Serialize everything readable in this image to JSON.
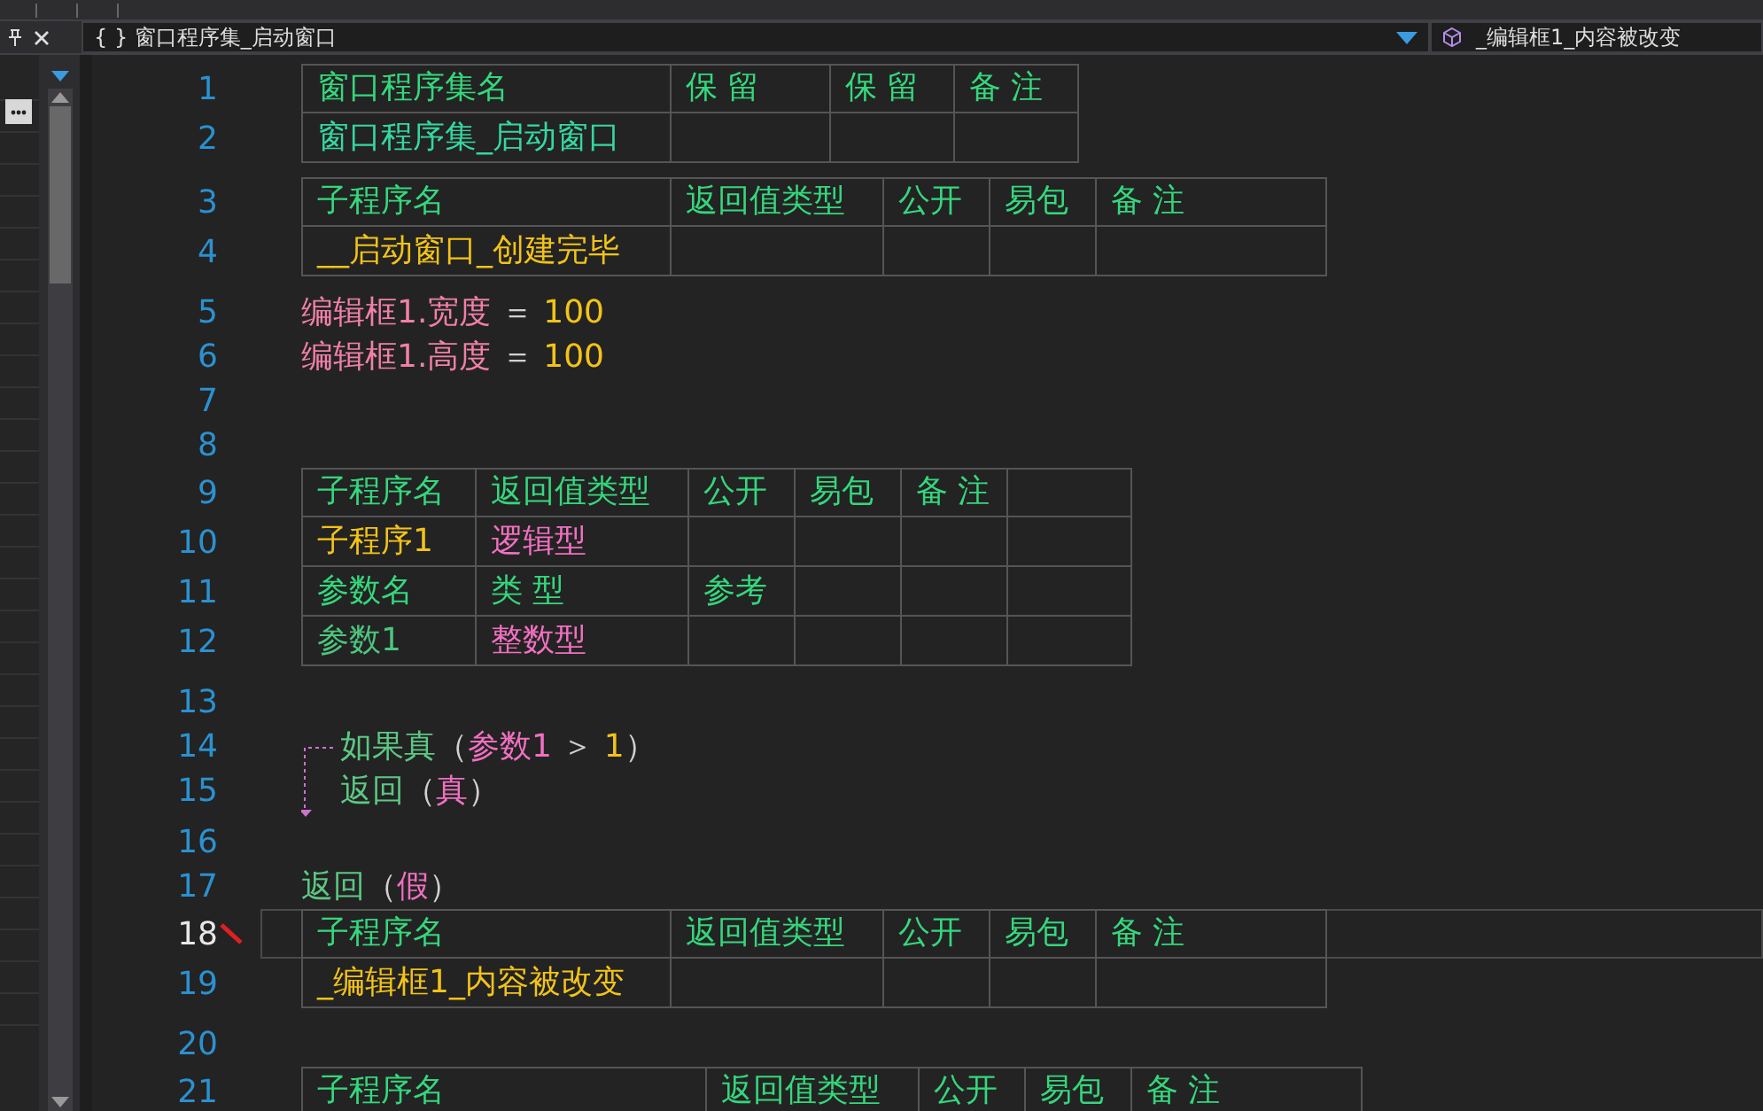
{
  "tab_bar": {
    "class_selector": "{ } 窗口程序集_启动窗口",
    "method_selector": "_编辑框1_内容被改变"
  },
  "lines": [
    {
      "kind": "table",
      "rows": [
        {
          "number": "1",
          "current": false,
          "cells": [
            {
              "text": "窗口程序集名",
              "color": "#35d77c"
            },
            {
              "text": "保 留",
              "color": "#35d77c"
            },
            {
              "text": "保 留",
              "color": "#35d77c"
            },
            {
              "text": "备 注",
              "color": "#35d77c"
            }
          ]
        },
        {
          "number": "2",
          "current": false,
          "cells": [
            {
              "text": "窗口程序集_启动窗口",
              "color": "#35d7a0"
            }
          ]
        }
      ]
    },
    {
      "kind": "table",
      "rows": [
        {
          "number": "3",
          "current": false,
          "cells": [
            {
              "text": "子程序名",
              "color": "#35d77c"
            },
            {
              "text": "返回值类型",
              "color": "#35d77c"
            },
            {
              "text": "公开",
              "color": "#35d77c"
            },
            {
              "text": "易包",
              "color": "#35d77c"
            },
            {
              "text": "备 注",
              "color": "#35d77c"
            }
          ]
        },
        {
          "number": "4",
          "current": false,
          "cells": [
            {
              "text": "__启动窗口_创建完毕",
              "color": "#f2c318"
            }
          ]
        }
      ]
    },
    {
      "kind": "code",
      "number": "5",
      "tokens": [
        {
          "text": "编辑框1.宽度",
          "color": "#f080a8"
        },
        {
          "text": " ＝ ",
          "color": "#d0d0d0"
        },
        {
          "text": "100",
          "color": "#f2c318"
        }
      ]
    },
    {
      "kind": "code",
      "number": "6",
      "tokens": [
        {
          "text": "编辑框1.高度",
          "color": "#f080a8"
        },
        {
          "text": " ＝ ",
          "color": "#d0d0d0"
        },
        {
          "text": "100",
          "color": "#f2c318"
        }
      ]
    },
    {
      "kind": "blank",
      "number": "7"
    },
    {
      "kind": "blank",
      "number": "8"
    },
    {
      "kind": "table",
      "rows": [
        {
          "number": "9",
          "current": false,
          "cells": [
            {
              "text": "子程序名",
              "color": "#35d77c"
            },
            {
              "text": "返回值类型",
              "color": "#35d77c"
            },
            {
              "text": "公开",
              "color": "#35d77c"
            },
            {
              "text": "易包",
              "color": "#35d77c"
            },
            {
              "text": "备 注",
              "color": "#35d77c"
            }
          ]
        },
        {
          "number": "10",
          "current": false,
          "cells": [
            {
              "text": "子程序1",
              "color": "#f2c318"
            },
            {
              "text": "逻辑型",
              "color": "#f070c0"
            }
          ]
        },
        {
          "number": "11",
          "current": false,
          "cells": [
            {
              "text": "参数名",
              "color": "#35d77c"
            },
            {
              "text": "类 型",
              "color": "#35d77c"
            },
            {
              "text": "参考",
              "color": "#35d77c"
            }
          ]
        },
        {
          "number": "12",
          "current": false,
          "cells": [
            {
              "text": "参数1",
              "color": "#4cc67e"
            },
            {
              "text": "整数型",
              "color": "#f070c0"
            }
          ]
        }
      ]
    },
    {
      "kind": "blank",
      "number": "13"
    },
    {
      "kind": "if_block",
      "lines": [
        {
          "number": "14",
          "tokens": [
            {
              "text": "如果真",
              "color": "#5cc884"
            },
            {
              "text": "（",
              "color": "#d0d0d0"
            },
            {
              "text": "参数1",
              "color": "#f070c0"
            },
            {
              "text": " ＞ ",
              "color": "#d0d0d0"
            },
            {
              "text": "1",
              "color": "#f2c318"
            },
            {
              "text": "）",
              "color": "#d0d0d0"
            }
          ]
        },
        {
          "number": "15",
          "tokens": [
            {
              "text": "返回",
              "color": "#5cc884"
            },
            {
              "text": "（",
              "color": "#d0d0d0"
            },
            {
              "text": "真",
              "color": "#f070c0"
            },
            {
              "text": "）",
              "color": "#d0d0d0"
            }
          ]
        }
      ]
    },
    {
      "kind": "blank",
      "number": "16"
    },
    {
      "kind": "code",
      "number": "17",
      "tokens": [
        {
          "text": "返回",
          "color": "#5cc884"
        },
        {
          "text": "（",
          "color": "#d0d0d0"
        },
        {
          "text": "假",
          "color": "#f070c0"
        },
        {
          "text": "）",
          "color": "#d0d0d0"
        }
      ]
    },
    {
      "kind": "table",
      "rows": [
        {
          "number": "18",
          "current": true,
          "cells": [
            {
              "text": "子程序名",
              "color": "#35d77c"
            },
            {
              "text": "返回值类型",
              "color": "#35d77c"
            },
            {
              "text": "公开",
              "color": "#35d77c"
            },
            {
              "text": "易包",
              "color": "#35d77c"
            },
            {
              "text": "备 注",
              "color": "#35d77c"
            }
          ]
        },
        {
          "number": "19",
          "current": false,
          "cells": [
            {
              "text": "_编辑框1_内容被改变",
              "color": "#f2c318"
            }
          ]
        }
      ]
    },
    {
      "kind": "blank",
      "number": "20"
    },
    {
      "kind": "table",
      "rows": [
        {
          "number": "21",
          "current": false,
          "cells": [
            {
              "text": "子程序名",
              "color": "#35d77c"
            },
            {
              "text": "返回值类型",
              "color": "#35d77c"
            },
            {
              "text": "公开",
              "color": "#35d77c"
            },
            {
              "text": "易包",
              "color": "#35d77c"
            },
            {
              "text": "备 注",
              "color": "#35d77c"
            }
          ]
        }
      ]
    }
  ]
}
